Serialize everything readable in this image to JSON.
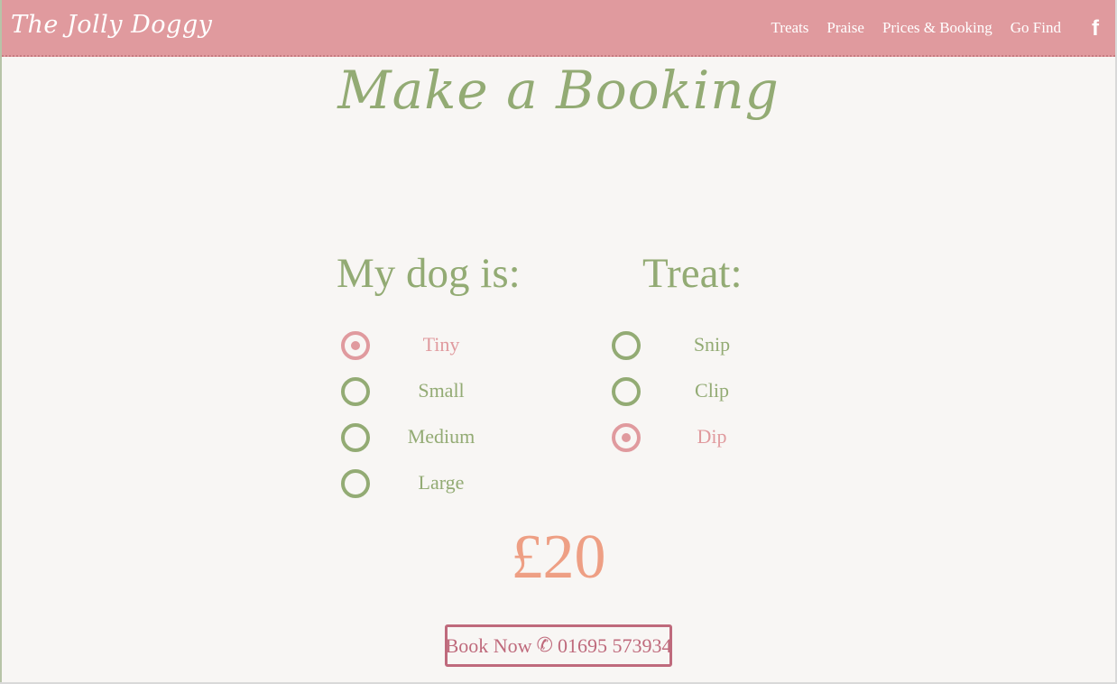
{
  "brand": "The Jolly Doggy",
  "nav": {
    "links": [
      {
        "label": "Treats"
      },
      {
        "label": "Praise"
      },
      {
        "label": "Prices & Booking"
      },
      {
        "label": "Go Find"
      }
    ],
    "facebook_icon": "facebook-icon",
    "facebook_glyph": "f"
  },
  "title": "Make a Booking",
  "dog_size": {
    "heading": "My dog is:",
    "options": [
      {
        "label": "Tiny",
        "selected": true
      },
      {
        "label": "Small",
        "selected": false
      },
      {
        "label": "Medium",
        "selected": false
      },
      {
        "label": "Large",
        "selected": false
      }
    ]
  },
  "treat": {
    "heading": "Treat:",
    "options": [
      {
        "label": "Snip",
        "selected": false
      },
      {
        "label": "Clip",
        "selected": false
      },
      {
        "label": "Dip",
        "selected": true
      }
    ]
  },
  "price": "£20",
  "booking": {
    "label": "Book Now",
    "phone_icon": "phone-icon",
    "phone_glyph": "✆",
    "phone": "01695 573934"
  },
  "colors": {
    "header_bg": "#e09a9e",
    "accent_green": "#93ab74",
    "accent_pink": "#e09a9e",
    "price_color": "#ee9f84",
    "button_color": "#bf6a7c",
    "page_bg": "#f8f6f4"
  }
}
